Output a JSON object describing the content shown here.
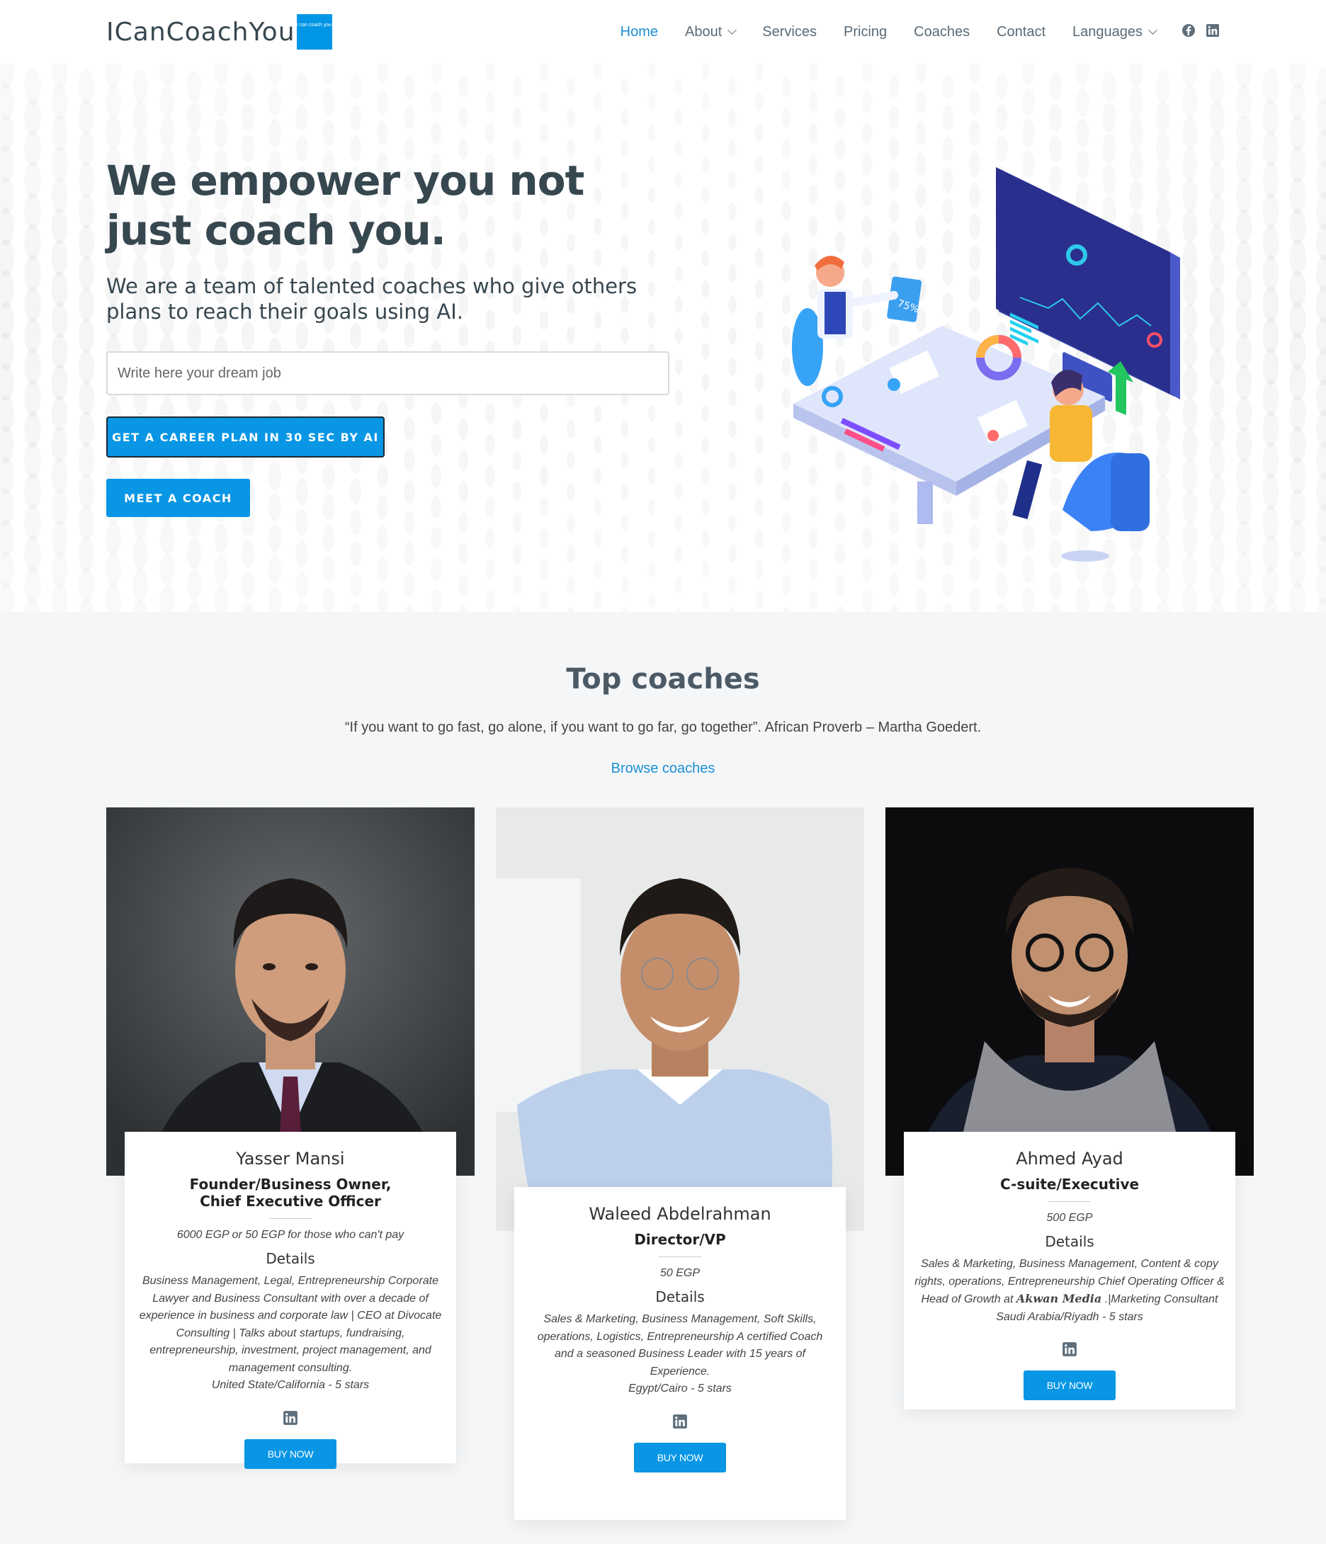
{
  "header": {
    "logo_text": "ICanCoachYou",
    "logo_badge": "I can coach you",
    "nav": [
      {
        "label": "Home",
        "active": true
      },
      {
        "label": "About",
        "dropdown": true
      },
      {
        "label": "Services"
      },
      {
        "label": "Pricing"
      },
      {
        "label": "Coaches"
      },
      {
        "label": "Contact"
      },
      {
        "label": "Languages",
        "dropdown": true
      }
    ],
    "social": [
      "facebook-icon",
      "linkedin-icon"
    ]
  },
  "hero": {
    "title": "We empower you not just coach you.",
    "subtitle": "We are a team of talented coaches who give others plans to reach their goals using AI.",
    "input_placeholder": "Write here your dream job",
    "plan_button": "GET A CAREER PLAN IN 30 SEC BY AI",
    "meet_button": "MEET A COACH",
    "illustration_badge": "75%"
  },
  "coaches_section": {
    "title": "Top coaches",
    "quote": "“If you want to go fast, go alone, if you want to go far, go together”. African Proverb – Martha Goedert.",
    "browse_link": "Browse coaches",
    "coaches": [
      {
        "name": "Yasser Mansi",
        "role": "Founder/Business Owner, Chief Executive Officer",
        "price": "6000 EGP or 50 EGP for those who can't pay",
        "details_label": "Details",
        "details": "Business Management, Legal, Entrepreneurship Corporate Lawyer and Business Consultant with over a decade of experience in business and corporate law | CEO at Divocate Consulting | Talks about startups, fundraising, entrepreneurship, investment, project management, and management consulting.",
        "location": "United State/California - 5 stars",
        "buy": "BUY NOW"
      },
      {
        "name": "Waleed Abdelrahman",
        "role": "Director/VP",
        "price": "50 EGP",
        "details_label": "Details",
        "details": "Sales & Marketing, Business Management, Soft Skills, operations, Logistics, Entrepreneurship A certified Coach and a seasoned Business Leader with 15 years of Experience.",
        "location": "Egypt/Cairo - 5 stars",
        "buy": "BUY NOW"
      },
      {
        "name": "Ahmed Ayad",
        "role": "C-suite/Executive",
        "price": "500 EGP",
        "details_label": "Details",
        "details_a": "Sales & Marketing, Business Management, Content & copy rights, operations, Entrepreneurship Chief Operating Officer & Head of Growth at ",
        "details_brand": "Akwan Media",
        "details_b": " .|Marketing Consultant",
        "location": "Saudi Arabia/Riyadh - 5 stars",
        "buy": "BUY NOW"
      }
    ]
  },
  "colors": {
    "accent": "#0896e5",
    "link": "#1b8fd6",
    "heading": "#37474f",
    "section_bg": "#f4f6f8"
  }
}
